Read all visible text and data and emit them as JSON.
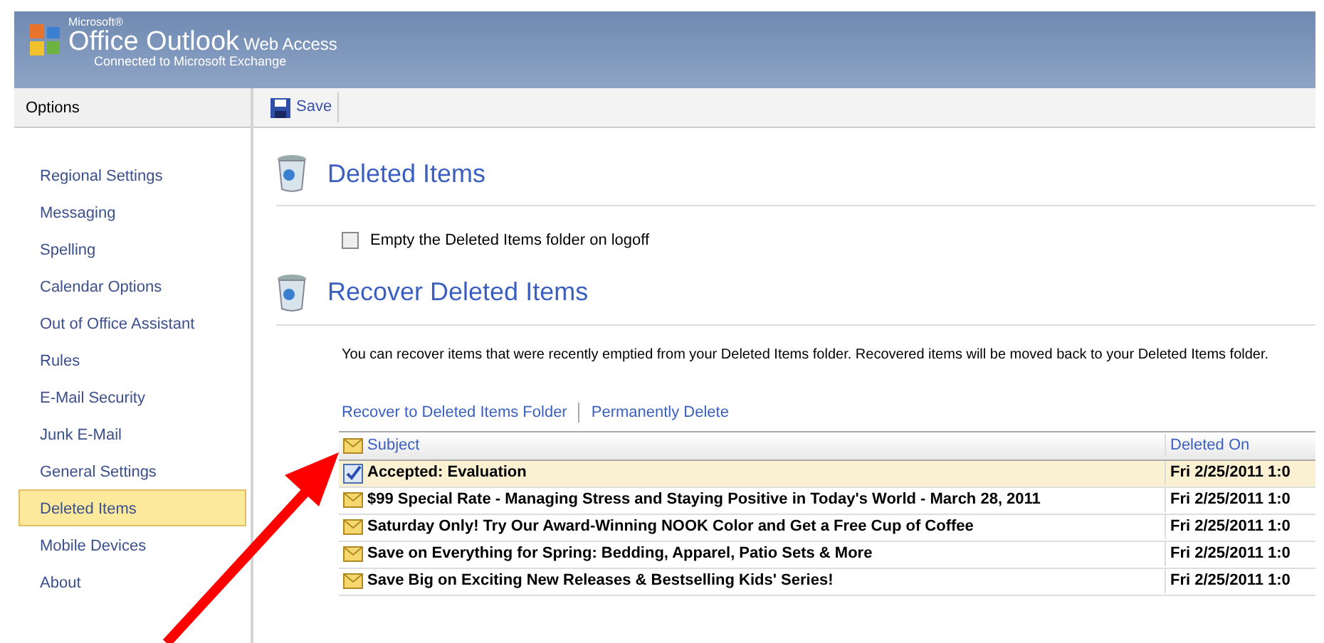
{
  "header": {
    "brand_small": "Microsoft®",
    "brand_name": "Office Outlook",
    "brand_suffix": "Web Access",
    "subtitle": "Connected to Microsoft Exchange"
  },
  "sidebar": {
    "title": "Options",
    "items": [
      {
        "label": "Regional Settings",
        "selected": false
      },
      {
        "label": "Messaging",
        "selected": false
      },
      {
        "label": "Spelling",
        "selected": false
      },
      {
        "label": "Calendar Options",
        "selected": false
      },
      {
        "label": "Out of Office Assistant",
        "selected": false
      },
      {
        "label": "Rules",
        "selected": false
      },
      {
        "label": "E-Mail Security",
        "selected": false
      },
      {
        "label": "Junk E-Mail",
        "selected": false
      },
      {
        "label": "General Settings",
        "selected": false
      },
      {
        "label": "Deleted Items",
        "selected": true
      },
      {
        "label": "Mobile Devices",
        "selected": false
      },
      {
        "label": "About",
        "selected": false
      }
    ]
  },
  "toolbar": {
    "save": "Save"
  },
  "deleted_items": {
    "heading": "Deleted Items",
    "option": {
      "label": "Empty the Deleted Items folder on logoff",
      "checked": false
    }
  },
  "recover": {
    "heading": "Recover Deleted Items",
    "description": "You can recover items that were recently emptied from your Deleted Items folder. Recovered items will be moved back to your Deleted Items folder.",
    "actions": [
      "Recover to Deleted Items Folder",
      "Permanently Delete"
    ]
  },
  "table": {
    "columns": [
      "Subject",
      "Deleted On"
    ],
    "rows": [
      {
        "kind": "meeting",
        "subject": "Accepted: Evaluation",
        "deleted_on": "Fri 2/25/2011 1:0",
        "selected": true
      },
      {
        "kind": "mail",
        "subject": "$99 Special Rate - Managing Stress and Staying Positive in Today's World - March 28, 2011",
        "deleted_on": "Fri 2/25/2011 1:0",
        "selected": false
      },
      {
        "kind": "mail",
        "subject": "Saturday Only! Try Our Award-Winning NOOK Color and Get a Free Cup of Coffee",
        "deleted_on": "Fri 2/25/2011 1:0",
        "selected": false
      },
      {
        "kind": "mail",
        "subject": "Save on Everything for Spring: Bedding, Apparel, Patio Sets & More",
        "deleted_on": "Fri 2/25/2011 1:0",
        "selected": false
      },
      {
        "kind": "mail",
        "subject": "Save Big on Exciting New Releases & Bestselling Kids' Series!",
        "deleted_on": "Fri 2/25/2011 1:0",
        "selected": false
      }
    ]
  }
}
